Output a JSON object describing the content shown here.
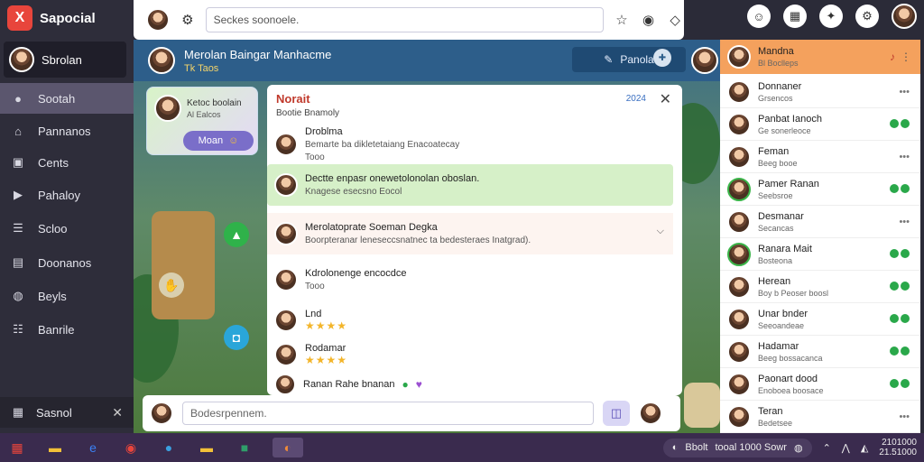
{
  "app": {
    "brand_logo": "X",
    "brand_name": "Sapocial"
  },
  "sidebar": {
    "profile_name": "Sbrolan",
    "items": [
      {
        "label": "Sootah",
        "icon": "avatar-icon",
        "active": true
      },
      {
        "label": "Pannanos",
        "icon": "home-icon"
      },
      {
        "label": "Cents",
        "icon": "screen-icon"
      },
      {
        "label": "Pahaloy",
        "icon": "media-icon"
      },
      {
        "label": "Scloo",
        "icon": "list-icon"
      },
      {
        "label": "Doonanos",
        "icon": "folder-icon"
      },
      {
        "label": "Beyls",
        "icon": "globe-icon"
      },
      {
        "label": "Banrile",
        "icon": "people-icon"
      }
    ],
    "bottom_label": "Sasnol",
    "bottom_close": "✕"
  },
  "topbar": {
    "search_placeholder": "Seckes soonoele."
  },
  "main": {
    "header_title": "Merolan Baingar Manhacme",
    "header_sub": "Tk Taos",
    "header_button": "Panola"
  },
  "notification": {
    "title": "Ketoc boolain",
    "sub": "Al Ealcos",
    "button": "Moan"
  },
  "chat": {
    "title": "Norait",
    "subtitle": "Bootie Bnamoly",
    "count": "2024",
    "close": "✕",
    "messages": [
      {
        "title": "Droblma",
        "text": "Bemarte ba dikletetaiang",
        "text2": "Enacoatecay",
        "sub": "Tooo"
      },
      {
        "title": "Dectte enpasr onewetolonolan oboslan.",
        "sub": "Knagese esecsno Eocol"
      },
      {
        "title": "Merolatoprate Soeman Degka",
        "sub": "Boorpteranar leneseccsnatnec ta bedesteraes Inatgrad)."
      },
      {
        "title": "Kdrolonenge encocdce",
        "sub": "Tooo"
      },
      {
        "title": "Lnd",
        "stars": "★★★★"
      },
      {
        "title": "Rodamar",
        "stars": "★★★★"
      },
      {
        "title": "Ranan Rahe bnanan"
      }
    ]
  },
  "composer": {
    "placeholder": "Bodesrpennem."
  },
  "friends": {
    "top": {
      "name": "Mandna",
      "sub": "Bl Boclleps"
    },
    "list": [
      {
        "name": "Donnaner",
        "sub": "Grsencos",
        "status": "more"
      },
      {
        "name": "Panbat Ianoch",
        "sub": "Ge sonerleoce",
        "status": "online"
      },
      {
        "name": "Feman",
        "sub": "Beeg booe",
        "status": "more"
      },
      {
        "name": "Pamer Ranan",
        "sub": "Seebsroe",
        "status": "online"
      },
      {
        "name": "Desmanar",
        "sub": "Secancas",
        "status": "more"
      },
      {
        "name": "Ranara Mait",
        "sub": "Bosteona",
        "status": "online"
      },
      {
        "name": "Herean",
        "sub": "Boy b Peoser boosl",
        "status": "online"
      },
      {
        "name": "Unar bnder",
        "sub": "Seeoandeae",
        "status": "online"
      },
      {
        "name": "Hadamar",
        "sub": "Beeg bossacanca",
        "status": "online"
      },
      {
        "name": "Paonart dood",
        "sub": "Enoboea boosace",
        "status": "online"
      },
      {
        "name": "Teran",
        "sub": "Bedetsee",
        "status": "more"
      }
    ]
  },
  "taskbar": {
    "tray_text": "Bbolt",
    "tray_text2": "tooal 1000 Sowr",
    "clock_time": "2101000",
    "clock_date": "21.51000"
  },
  "colors": {
    "accent": "#2d5e8a",
    "brand": "#e8453c",
    "orange": "#f4a15d"
  }
}
